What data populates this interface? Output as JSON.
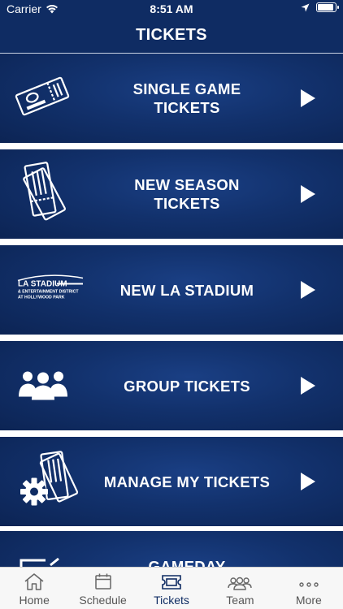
{
  "status_bar": {
    "carrier": "Carrier",
    "time": "8:51 AM",
    "battery_level": 0.95
  },
  "header": {
    "title": "TICKETS"
  },
  "tiles": [
    {
      "label": "SINGLE GAME\nTICKETS",
      "icon": "ticket-icon"
    },
    {
      "label": "NEW SEASON\nTICKETS",
      "icon": "season-tickets-icon"
    },
    {
      "label": "NEW LA STADIUM",
      "icon": "la-stadium-logo",
      "logo_title": "LA STADIUM",
      "logo_line1": "& ENTERTAINMENT DISTRICT",
      "logo_line2": "AT HOLLYWOOD PARK"
    },
    {
      "label": "GROUP TICKETS",
      "icon": "group-icon"
    },
    {
      "label": "MANAGE MY TICKETS",
      "icon": "manage-tickets-icon"
    },
    {
      "label": "GAMEDAY",
      "icon": "gameday-icon"
    }
  ],
  "tab_bar": {
    "tabs": [
      {
        "label": "Home",
        "icon": "home-icon",
        "active": false
      },
      {
        "label": "Schedule",
        "icon": "calendar-icon",
        "active": false
      },
      {
        "label": "Tickets",
        "icon": "ticket-tab-icon",
        "active": true
      },
      {
        "label": "Team",
        "icon": "team-icon",
        "active": false
      },
      {
        "label": "More",
        "icon": "more-icon",
        "active": false
      }
    ]
  }
}
